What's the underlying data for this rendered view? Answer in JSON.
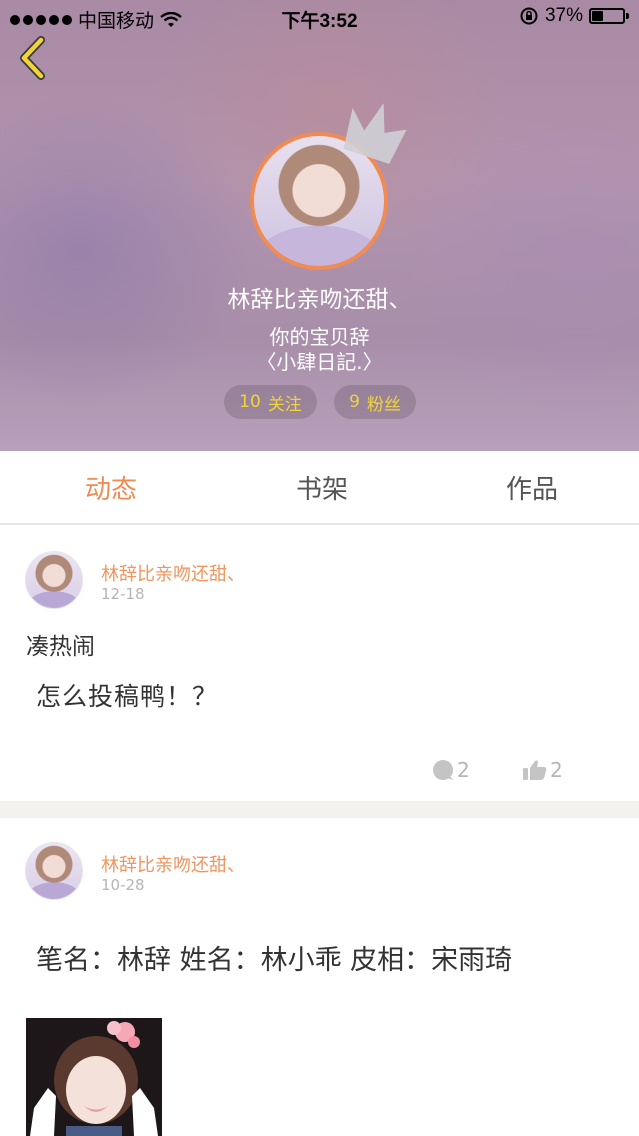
{
  "status_bar": {
    "carrier": "中国移动",
    "time": "下午3:52",
    "battery": "37%",
    "battery_level": 0.37
  },
  "profile": {
    "nickname": "林辞比亲吻还甜、",
    "signature_line1": "你的宝贝辞",
    "signature_line2": "〈小肆日記.〉",
    "follow_count": "10",
    "follow_label": "关注",
    "fans_count": "9",
    "fans_label": "粉丝"
  },
  "tabs": [
    {
      "label": "动态",
      "active": true
    },
    {
      "label": "书架",
      "active": false
    },
    {
      "label": "作品",
      "active": false
    }
  ],
  "posts": [
    {
      "author": "林辞比亲吻还甜、",
      "date": "12-18",
      "title": "凑热闹",
      "body": "怎么投稿鸭！？",
      "comments": "2",
      "likes": "2"
    },
    {
      "author": "林辞比亲吻还甜、",
      "date": "10-28",
      "body": "笔名：林辞 姓名：林小乖 皮相：宋雨琦"
    }
  ],
  "colors": {
    "accent": "#f08b53",
    "pill_text": "#f2d33a",
    "muted": "#b5b5b5",
    "text": "#333333"
  },
  "icons": [
    "back-arrow-icon",
    "crown-icon",
    "comment-icon",
    "thumbs-up-icon",
    "wifi-icon",
    "rotation-lock-icon",
    "battery-icon"
  ]
}
